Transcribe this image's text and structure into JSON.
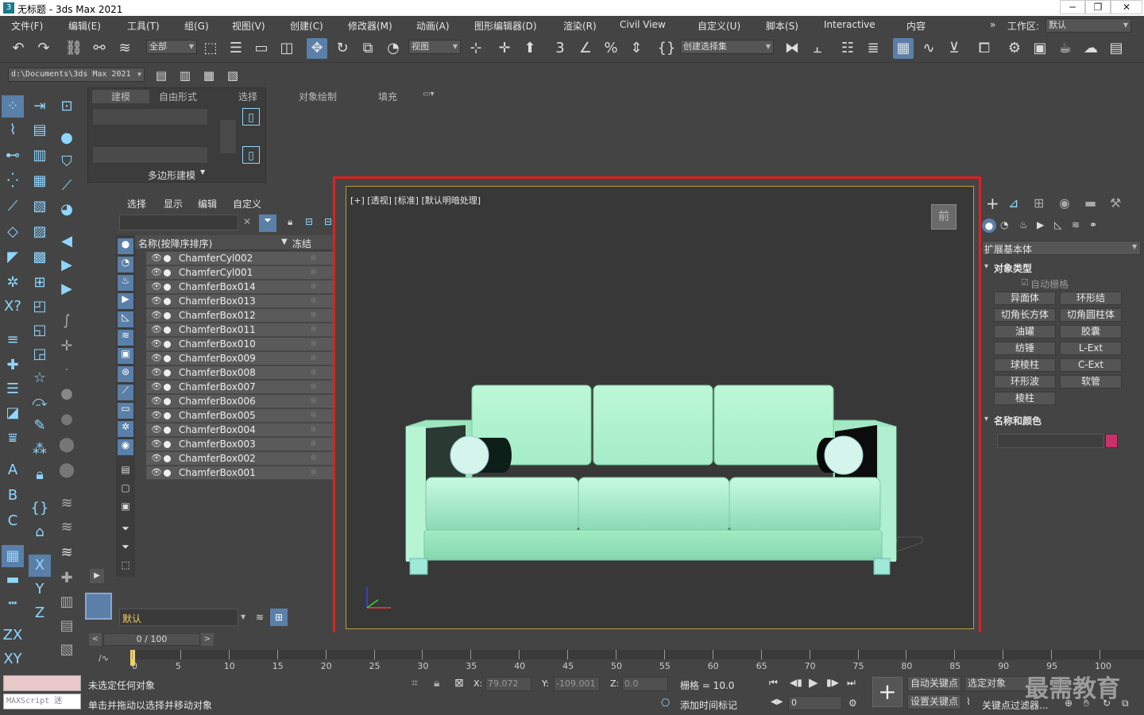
{
  "window": {
    "title": "无标题 - 3ds Max 2021"
  },
  "menubar": {
    "items": [
      "文件(F)",
      "编辑(E)",
      "工具(T)",
      "组(G)",
      "视图(V)",
      "创建(C)",
      "修改器(M)",
      "动画(A)",
      "图形编辑器(D)",
      "渲染(R)",
      "Civil View",
      "自定义(U)",
      "脚本(S)",
      "Interactive",
      "内容"
    ],
    "workspace_label": "工作区:",
    "workspace_value": "默认"
  },
  "toolbar": {
    "selection_filter": "全部",
    "ref_coord": "视图",
    "named_selection": "创建选择集"
  },
  "path_bar": {
    "path": "d:\\Documents\\3ds Max 2021"
  },
  "ribbon": {
    "tabs": [
      "建模",
      "自由形式",
      "选择",
      "对象绘制",
      "填充"
    ],
    "panel_label": "多边形建模"
  },
  "scene_explorer": {
    "tabs": [
      "选择",
      "显示",
      "编辑",
      "自定义"
    ],
    "col_name": "名称(按降序排序)",
    "col_freeze": "冻结",
    "rows": [
      "ChamferCyl002",
      "ChamferCyl001",
      "ChamferBox014",
      "ChamferBox013",
      "ChamferBox012",
      "ChamferBox011",
      "ChamferBox010",
      "ChamferBox009",
      "ChamferBox008",
      "ChamferBox007",
      "ChamferBox006",
      "ChamferBox005",
      "ChamferBox004",
      "ChamferBox003",
      "ChamferBox002",
      "ChamferBox001"
    ],
    "layer": "默认"
  },
  "viewport": {
    "label": "[+] [透视] [标准] [默认明暗处理]",
    "viewcube": "前"
  },
  "command_panel": {
    "category": "扩展基本体",
    "rollout_object_type": "对象类型",
    "autogrid": "自动栅格",
    "buttons": [
      "异面体",
      "环形结",
      "切角长方体",
      "切角圆柱体",
      "油罐",
      "胶囊",
      "纺锤",
      "L-Ext",
      "球棱柱",
      "C-Ext",
      "环形波",
      "软管",
      "棱柱"
    ],
    "rollout_name_color": "名称和颜色",
    "object_color": "#c8306a"
  },
  "timeline": {
    "frame_display": "0 / 100",
    "ticks": [
      "0",
      "5",
      "10",
      "15",
      "20",
      "25",
      "30",
      "35",
      "40",
      "45",
      "50",
      "55",
      "60",
      "65",
      "70",
      "75",
      "80",
      "85",
      "90",
      "95",
      "100"
    ]
  },
  "status": {
    "line1": "未选定任何对象",
    "line2": "单击并拖动以选择并移动对象",
    "maxscript": "MAXScript 迷",
    "x_label": "X:",
    "x_val": "79.072",
    "y_label": "Y:",
    "y_val": "-109.001",
    "z_label": "Z:",
    "z_val": "0.0",
    "grid": "栅格 = 10.0",
    "add_time_tag": "添加时间标记",
    "auto_key": "自动关键点",
    "set_key": "设置关键点",
    "selected_obj": "选定对象",
    "key_filter": "关键点过滤器...",
    "frame": "0",
    "watermark": "最需教育"
  }
}
